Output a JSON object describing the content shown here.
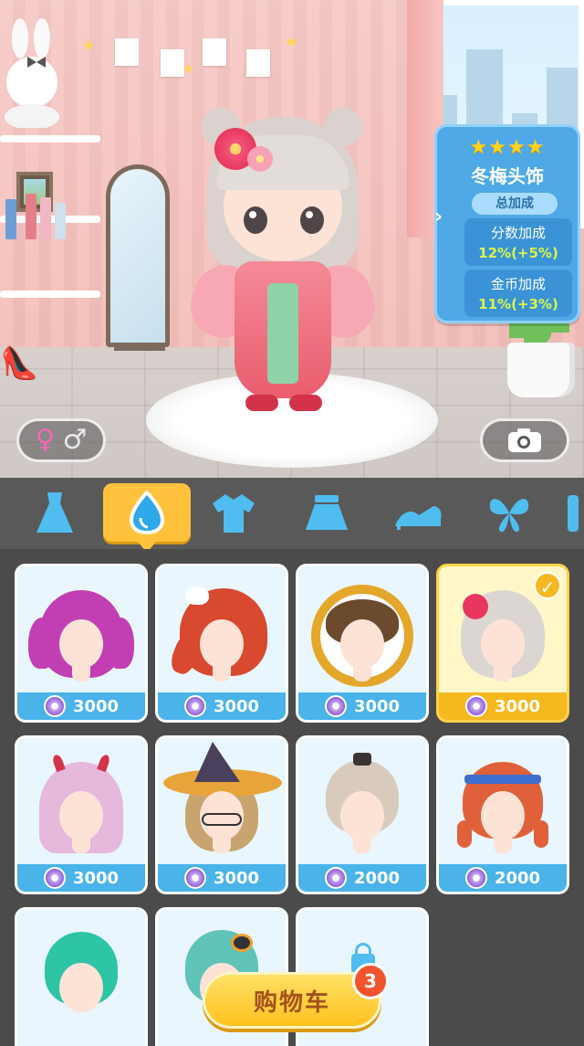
{
  "info_panel": {
    "stars": "★★★★",
    "item_name": "冬梅头饰",
    "bonus_title": "总加成",
    "score_bonus_label": "分数加成",
    "score_bonus_value": "12%(+5%)",
    "coin_bonus_label": "金币加成",
    "coin_bonus_value": "11%(+3%)"
  },
  "gender": {
    "female_symbol": "♀",
    "male_symbol": "♂"
  },
  "camera_icon": "camera-icon",
  "tabs": [
    {
      "icon": "dress-icon"
    },
    {
      "icon": "hair-icon",
      "active": true
    },
    {
      "icon": "shirt-icon"
    },
    {
      "icon": "skirt-icon"
    },
    {
      "icon": "shoe-icon"
    },
    {
      "icon": "butterfly-icon"
    }
  ],
  "items": [
    {
      "price": "3000",
      "hair_color": "#c13fb3"
    },
    {
      "price": "3000",
      "hair_color": "#d8492f"
    },
    {
      "price": "3000",
      "hair_color": "#6b4a2e"
    },
    {
      "price": "3000",
      "hair_color": "#dcd6d3",
      "selected": true
    },
    {
      "price": "3000",
      "hair_color": "#e6b8dc"
    },
    {
      "price": "3000",
      "hair_color": "#c8a46e"
    },
    {
      "price": "2000",
      "hair_color": "#d8cbbd"
    },
    {
      "price": "2000",
      "hair_color": "#e0603a"
    },
    {
      "hair_color": "#2ec4a6"
    },
    {
      "hair_color": "#5fc3b8"
    },
    {
      "locked": true
    }
  ],
  "cart": {
    "label": "购物车",
    "count": "3"
  },
  "colors": {
    "panel_blue": "#4ea9e6",
    "accent_yellow": "#ffc23c",
    "price_blue": "#49b3ea",
    "bonus_green": "#d9f74a"
  }
}
